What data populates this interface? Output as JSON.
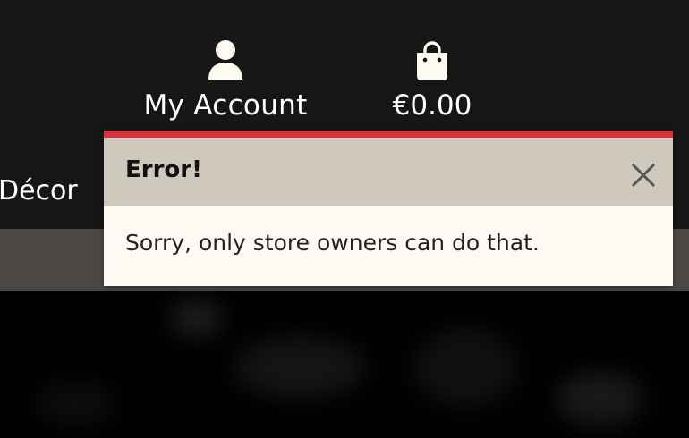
{
  "header": {
    "account": {
      "icon": "user-icon",
      "label": "My Account"
    },
    "bag": {
      "icon": "shopping-bag-icon",
      "total": "€0.00"
    },
    "nav": {
      "item_decor": "Décor"
    }
  },
  "toast": {
    "title": "Error!",
    "message": "Sorry, only store owners can do that.",
    "close_icon": "close-icon"
  },
  "colors": {
    "header_bg": "#161616",
    "nav_strip_bg": "#4a4745",
    "toast_accent": "#d6323f",
    "toast_header_bg": "#cec8bd",
    "toast_body_bg": "#fdfaf3",
    "icon_color": "#fdfaf0"
  }
}
